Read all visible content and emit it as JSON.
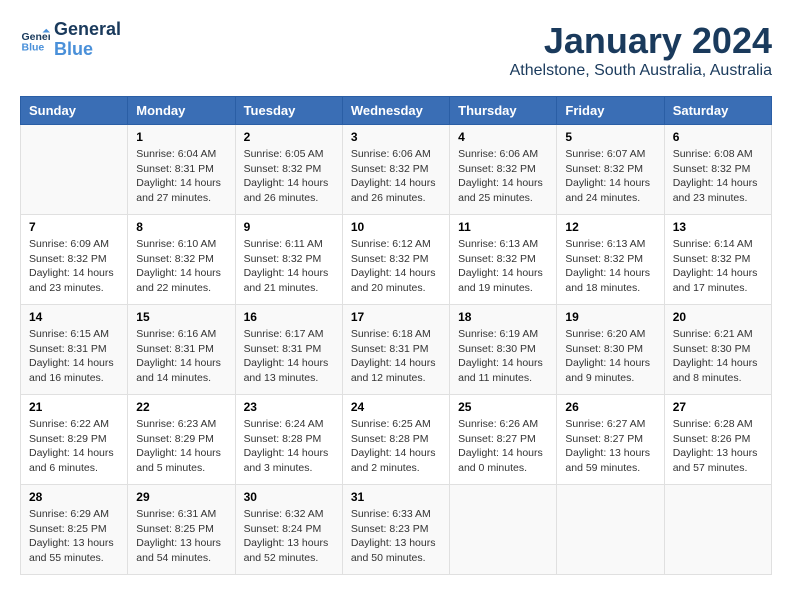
{
  "logo": {
    "line1": "General",
    "line2": "Blue"
  },
  "title": "January 2024",
  "subtitle": "Athelstone, South Australia, Australia",
  "days_of_week": [
    "Sunday",
    "Monday",
    "Tuesday",
    "Wednesday",
    "Thursday",
    "Friday",
    "Saturday"
  ],
  "weeks": [
    [
      {
        "day": "",
        "info": ""
      },
      {
        "day": "1",
        "info": "Sunrise: 6:04 AM\nSunset: 8:31 PM\nDaylight: 14 hours\nand 27 minutes."
      },
      {
        "day": "2",
        "info": "Sunrise: 6:05 AM\nSunset: 8:32 PM\nDaylight: 14 hours\nand 26 minutes."
      },
      {
        "day": "3",
        "info": "Sunrise: 6:06 AM\nSunset: 8:32 PM\nDaylight: 14 hours\nand 26 minutes."
      },
      {
        "day": "4",
        "info": "Sunrise: 6:06 AM\nSunset: 8:32 PM\nDaylight: 14 hours\nand 25 minutes."
      },
      {
        "day": "5",
        "info": "Sunrise: 6:07 AM\nSunset: 8:32 PM\nDaylight: 14 hours\nand 24 minutes."
      },
      {
        "day": "6",
        "info": "Sunrise: 6:08 AM\nSunset: 8:32 PM\nDaylight: 14 hours\nand 23 minutes."
      }
    ],
    [
      {
        "day": "7",
        "info": "Sunrise: 6:09 AM\nSunset: 8:32 PM\nDaylight: 14 hours\nand 23 minutes."
      },
      {
        "day": "8",
        "info": "Sunrise: 6:10 AM\nSunset: 8:32 PM\nDaylight: 14 hours\nand 22 minutes."
      },
      {
        "day": "9",
        "info": "Sunrise: 6:11 AM\nSunset: 8:32 PM\nDaylight: 14 hours\nand 21 minutes."
      },
      {
        "day": "10",
        "info": "Sunrise: 6:12 AM\nSunset: 8:32 PM\nDaylight: 14 hours\nand 20 minutes."
      },
      {
        "day": "11",
        "info": "Sunrise: 6:13 AM\nSunset: 8:32 PM\nDaylight: 14 hours\nand 19 minutes."
      },
      {
        "day": "12",
        "info": "Sunrise: 6:13 AM\nSunset: 8:32 PM\nDaylight: 14 hours\nand 18 minutes."
      },
      {
        "day": "13",
        "info": "Sunrise: 6:14 AM\nSunset: 8:32 PM\nDaylight: 14 hours\nand 17 minutes."
      }
    ],
    [
      {
        "day": "14",
        "info": "Sunrise: 6:15 AM\nSunset: 8:31 PM\nDaylight: 14 hours\nand 16 minutes."
      },
      {
        "day": "15",
        "info": "Sunrise: 6:16 AM\nSunset: 8:31 PM\nDaylight: 14 hours\nand 14 minutes."
      },
      {
        "day": "16",
        "info": "Sunrise: 6:17 AM\nSunset: 8:31 PM\nDaylight: 14 hours\nand 13 minutes."
      },
      {
        "day": "17",
        "info": "Sunrise: 6:18 AM\nSunset: 8:31 PM\nDaylight: 14 hours\nand 12 minutes."
      },
      {
        "day": "18",
        "info": "Sunrise: 6:19 AM\nSunset: 8:30 PM\nDaylight: 14 hours\nand 11 minutes."
      },
      {
        "day": "19",
        "info": "Sunrise: 6:20 AM\nSunset: 8:30 PM\nDaylight: 14 hours\nand 9 minutes."
      },
      {
        "day": "20",
        "info": "Sunrise: 6:21 AM\nSunset: 8:30 PM\nDaylight: 14 hours\nand 8 minutes."
      }
    ],
    [
      {
        "day": "21",
        "info": "Sunrise: 6:22 AM\nSunset: 8:29 PM\nDaylight: 14 hours\nand 6 minutes."
      },
      {
        "day": "22",
        "info": "Sunrise: 6:23 AM\nSunset: 8:29 PM\nDaylight: 14 hours\nand 5 minutes."
      },
      {
        "day": "23",
        "info": "Sunrise: 6:24 AM\nSunset: 8:28 PM\nDaylight: 14 hours\nand 3 minutes."
      },
      {
        "day": "24",
        "info": "Sunrise: 6:25 AM\nSunset: 8:28 PM\nDaylight: 14 hours\nand 2 minutes."
      },
      {
        "day": "25",
        "info": "Sunrise: 6:26 AM\nSunset: 8:27 PM\nDaylight: 14 hours\nand 0 minutes."
      },
      {
        "day": "26",
        "info": "Sunrise: 6:27 AM\nSunset: 8:27 PM\nDaylight: 13 hours\nand 59 minutes."
      },
      {
        "day": "27",
        "info": "Sunrise: 6:28 AM\nSunset: 8:26 PM\nDaylight: 13 hours\nand 57 minutes."
      }
    ],
    [
      {
        "day": "28",
        "info": "Sunrise: 6:29 AM\nSunset: 8:25 PM\nDaylight: 13 hours\nand 55 minutes."
      },
      {
        "day": "29",
        "info": "Sunrise: 6:31 AM\nSunset: 8:25 PM\nDaylight: 13 hours\nand 54 minutes."
      },
      {
        "day": "30",
        "info": "Sunrise: 6:32 AM\nSunset: 8:24 PM\nDaylight: 13 hours\nand 52 minutes."
      },
      {
        "day": "31",
        "info": "Sunrise: 6:33 AM\nSunset: 8:23 PM\nDaylight: 13 hours\nand 50 minutes."
      },
      {
        "day": "",
        "info": ""
      },
      {
        "day": "",
        "info": ""
      },
      {
        "day": "",
        "info": ""
      }
    ]
  ]
}
